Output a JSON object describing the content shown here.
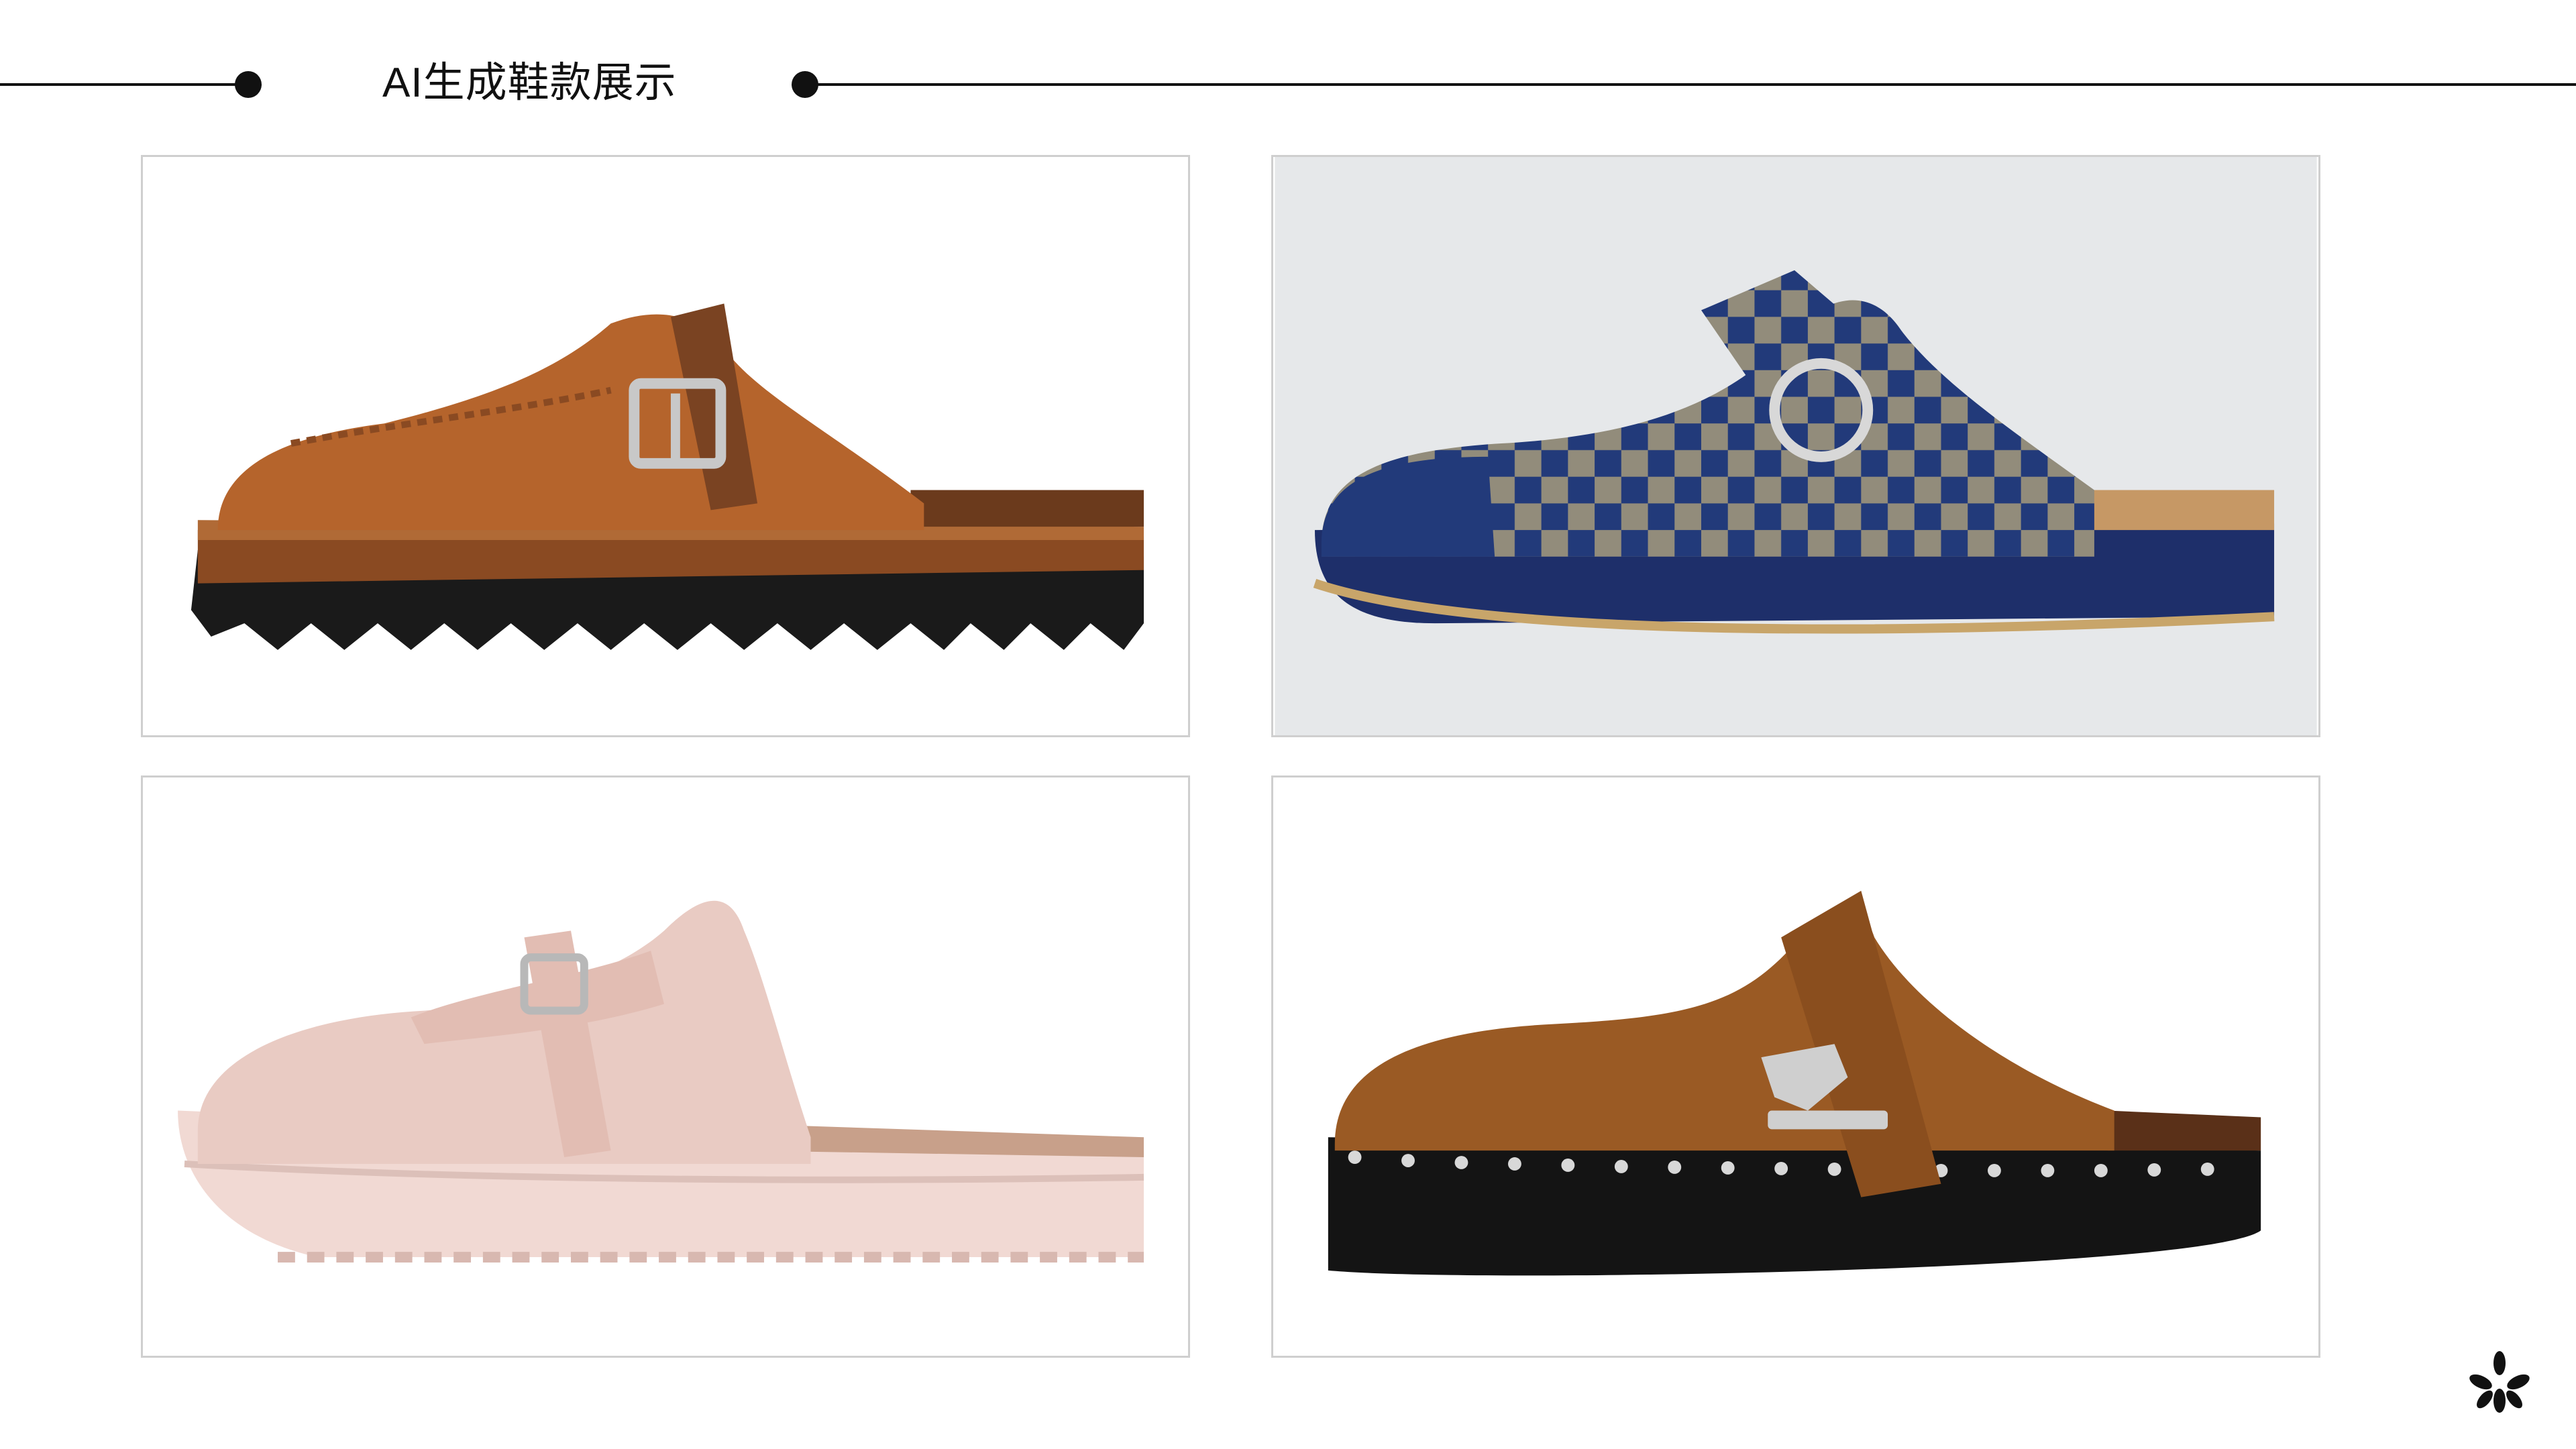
{
  "header": {
    "title": "AI生成鞋款展示"
  },
  "gallery": {
    "items": [
      {
        "icon": "brown-suede-mule-image",
        "colors": {
          "upper": "#b5642c",
          "sole": "#1a1a1a",
          "strap": "#7a4322",
          "buckle": "#c8c8c8"
        }
      },
      {
        "icon": "navy-checkered-clog-image",
        "colors": {
          "upper": "#223a7a",
          "pattern": "#b7a77a",
          "sole": "#1e2f6a",
          "background": "#e6e8ea"
        }
      },
      {
        "icon": "pink-suede-mule-image",
        "colors": {
          "upper": "#e9cbc3",
          "sole": "#f1d9d3",
          "buckle": "#b8b8b8"
        }
      },
      {
        "icon": "tan-studded-clog-image",
        "colors": {
          "upper": "#9a5a24",
          "sole": "#141414",
          "studs": "#d8d8d8",
          "buckle": "#cfcfcf"
        }
      }
    ]
  },
  "brand": {
    "icon": "sparkle-logo-icon",
    "color": "#111111"
  }
}
